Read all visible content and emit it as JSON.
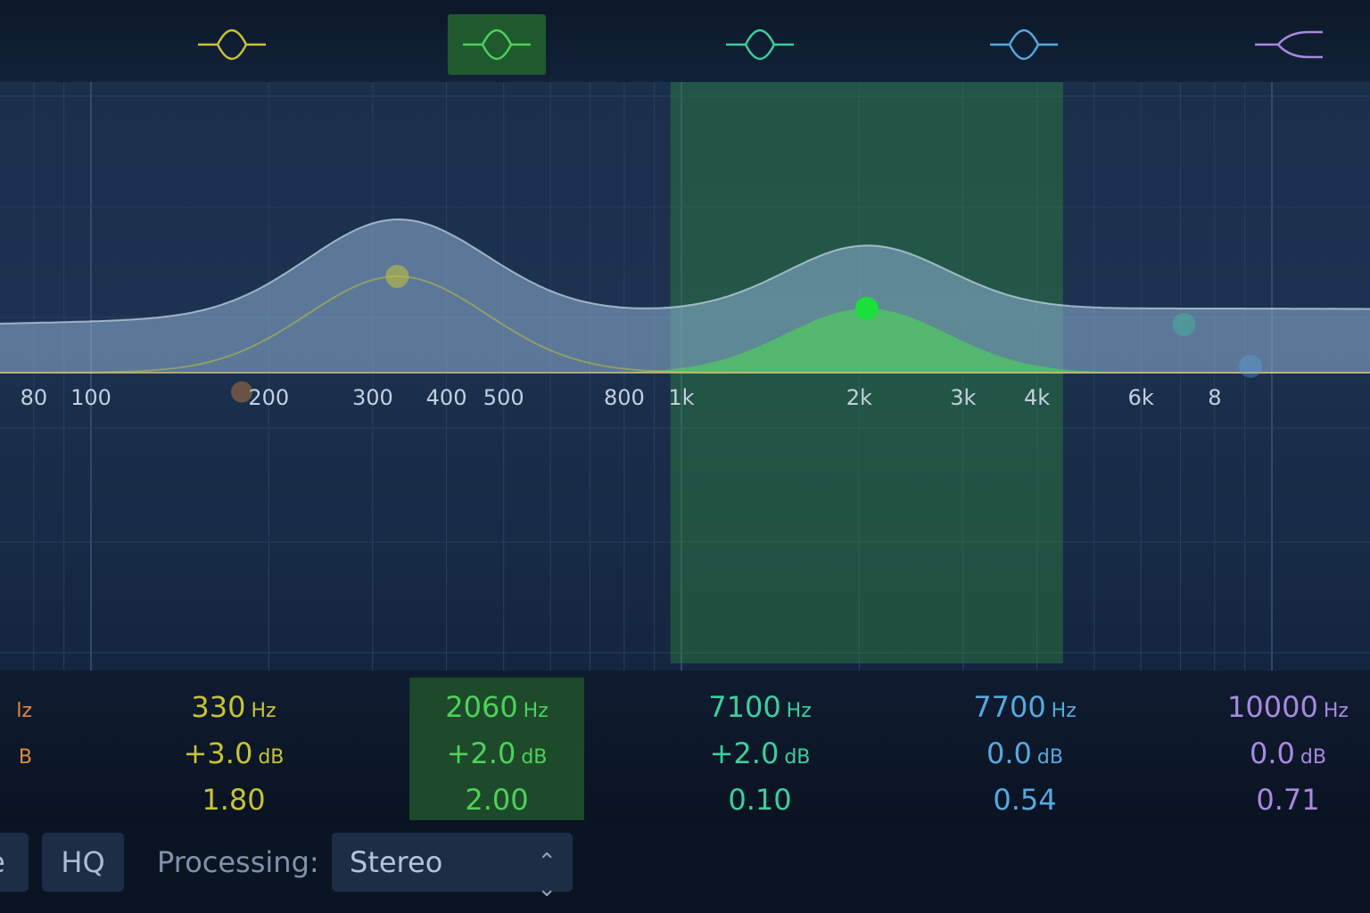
{
  "colors": {
    "band1": "#e08a3a",
    "band2": "#c9c237",
    "band3": "#4ed15a",
    "band4": "#3ccf9e",
    "band5": "#58a8e0",
    "band6": "#a889e0",
    "selected_bg": "#1f5a2e",
    "active_range": "#2f8a3e"
  },
  "band_buttons": [
    {
      "icon": "peak-filter-icon",
      "color_key": "band2",
      "selected": false
    },
    {
      "icon": "peak-filter-icon",
      "color_key": "band3",
      "selected": true
    },
    {
      "icon": "peak-filter-icon",
      "color_key": "band4",
      "selected": false
    },
    {
      "icon": "peak-filter-icon",
      "color_key": "band5",
      "selected": false
    },
    {
      "icon": "high-shelf-icon",
      "color_key": "band6",
      "selected": false
    }
  ],
  "freq_axis": {
    "labels": [
      "80",
      "100",
      "200",
      "300",
      "400",
      "500",
      "800",
      "1k",
      "2k",
      "3k",
      "4k",
      "6k",
      "8"
    ]
  },
  "bands": [
    {
      "freq": "",
      "freq_unit": "Hz",
      "gain": "",
      "gain_unit": "dB",
      "q": "",
      "color_key": "band1",
      "selected": false
    },
    {
      "freq": "330",
      "freq_unit": "Hz",
      "gain": "+3.0",
      "gain_unit": "dB",
      "q": "1.80",
      "color_key": "band2",
      "selected": false
    },
    {
      "freq": "2060",
      "freq_unit": "Hz",
      "gain": "+2.0",
      "gain_unit": "dB",
      "q": "2.00",
      "color_key": "band3",
      "selected": true
    },
    {
      "freq": "7100",
      "freq_unit": "Hz",
      "gain": "+2.0",
      "gain_unit": "dB",
      "q": "0.10",
      "color_key": "band4",
      "selected": false
    },
    {
      "freq": "7700",
      "freq_unit": "Hz",
      "gain": "0.0",
      "gain_unit": "dB",
      "q": "0.54",
      "color_key": "band5",
      "selected": false
    },
    {
      "freq": "10000",
      "freq_unit": "Hz",
      "gain": "0.0",
      "gain_unit": "dB",
      "q": "0.71",
      "color_key": "band6",
      "selected": false
    }
  ],
  "partial_labels": {
    "freq_unit_tail": "lz",
    "gain_unit_tail": "B"
  },
  "bottom": {
    "partial_button_label": "e",
    "hq_label": "HQ",
    "processing_label": "Processing:",
    "processing_value": "Stereo"
  }
}
